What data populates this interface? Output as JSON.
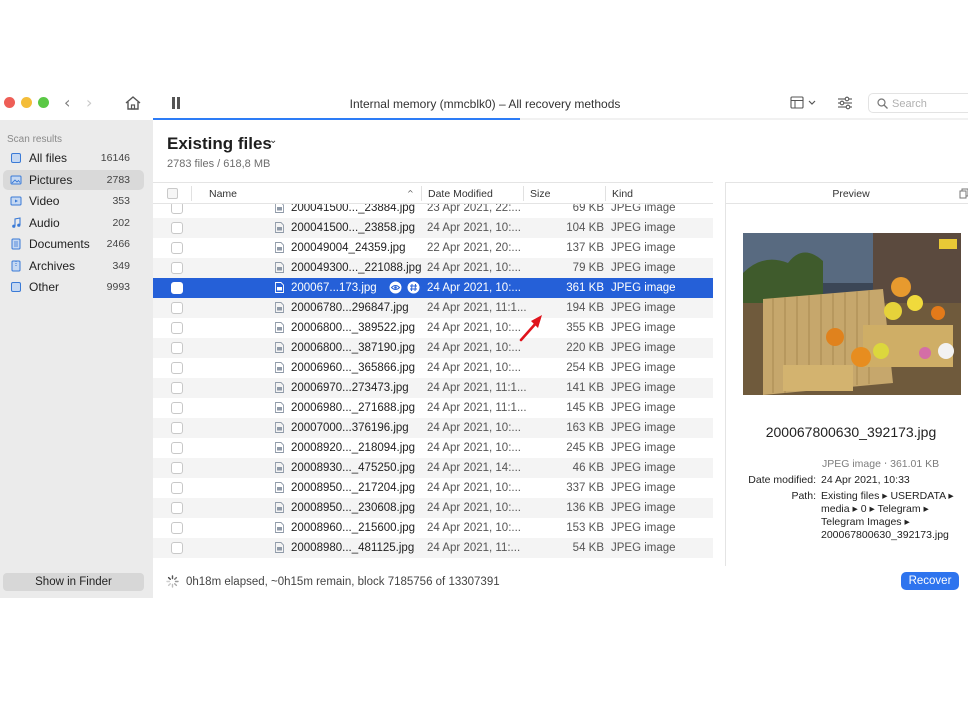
{
  "window": {
    "title": "Internal memory (mmcblk0) – All recovery methods",
    "scan_progress_percent": 45
  },
  "search": {
    "placeholder": "Search"
  },
  "sidebar": {
    "heading": "Scan results",
    "items": [
      {
        "label": "All files",
        "count": "16146",
        "icon": "files-icon"
      },
      {
        "label": "Pictures",
        "count": "2783",
        "icon": "pictures-icon",
        "selected": true
      },
      {
        "label": "Video",
        "count": "353",
        "icon": "video-icon"
      },
      {
        "label": "Audio",
        "count": "202",
        "icon": "audio-icon"
      },
      {
        "label": "Documents",
        "count": "2466",
        "icon": "documents-icon"
      },
      {
        "label": "Archives",
        "count": "349",
        "icon": "archives-icon"
      },
      {
        "label": "Other",
        "count": "9993",
        "icon": "other-icon"
      }
    ],
    "show_in_finder": "Show in Finder"
  },
  "main": {
    "title": "Existing files",
    "subtitle": "2783 files / 618,8 MB",
    "columns": {
      "name": "Name",
      "date": "Date Modified",
      "size": "Size",
      "kind": "Kind"
    },
    "rows": [
      {
        "name": "200041500..._23884.jpg",
        "date": "23 Apr 2021, 22:...",
        "size": "69 KB",
        "kind": "JPEG image"
      },
      {
        "name": "200041500..._23858.jpg",
        "date": "24 Apr 2021, 10:...",
        "size": "104 KB",
        "kind": "JPEG image"
      },
      {
        "name": "200049004_24359.jpg",
        "date": "22 Apr 2021, 20:...",
        "size": "137 KB",
        "kind": "JPEG image"
      },
      {
        "name": "200049300..._221088.jpg",
        "date": "24 Apr 2021, 10:...",
        "size": "79 KB",
        "kind": "JPEG image"
      },
      {
        "name": "200067...173.jpg",
        "date": "24 Apr 2021, 10:...",
        "size": "361 KB",
        "kind": "JPEG image",
        "selected": true
      },
      {
        "name": "20006780...296847.jpg",
        "date": "24 Apr 2021, 11:1...",
        "size": "194 KB",
        "kind": "JPEG image"
      },
      {
        "name": "20006800..._389522.jpg",
        "date": "24 Apr 2021, 10:...",
        "size": "355 KB",
        "kind": "JPEG image"
      },
      {
        "name": "20006800..._387190.jpg",
        "date": "24 Apr 2021, 10:...",
        "size": "220 KB",
        "kind": "JPEG image"
      },
      {
        "name": "20006960..._365866.jpg",
        "date": "24 Apr 2021, 10:...",
        "size": "254 KB",
        "kind": "JPEG image"
      },
      {
        "name": "20006970...273473.jpg",
        "date": "24 Apr 2021, 11:1...",
        "size": "141 KB",
        "kind": "JPEG image"
      },
      {
        "name": "20006980..._271688.jpg",
        "date": "24 Apr 2021, 11:1...",
        "size": "145 KB",
        "kind": "JPEG image"
      },
      {
        "name": "20007000...376196.jpg",
        "date": "24 Apr 2021, 10:...",
        "size": "163 KB",
        "kind": "JPEG image"
      },
      {
        "name": "20008920..._218094.jpg",
        "date": "24 Apr 2021, 10:...",
        "size": "245 KB",
        "kind": "JPEG image"
      },
      {
        "name": "20008930..._475250.jpg",
        "date": "24 Apr 2021, 14:...",
        "size": "46 KB",
        "kind": "JPEG image"
      },
      {
        "name": "20008950..._217204.jpg",
        "date": "24 Apr 2021, 10:...",
        "size": "337 KB",
        "kind": "JPEG image"
      },
      {
        "name": "20008950..._230608.jpg",
        "date": "24 Apr 2021, 10:...",
        "size": "136 KB",
        "kind": "JPEG image"
      },
      {
        "name": "20008960..._215600.jpg",
        "date": "24 Apr 2021, 10:...",
        "size": "153 KB",
        "kind": "JPEG image"
      },
      {
        "name": "20008980..._481125.jpg",
        "date": "24 Apr 2021, 11:...",
        "size": "54 KB",
        "kind": "JPEG image"
      }
    ]
  },
  "preview": {
    "heading": "Preview",
    "filename": "200067800630_392173.jpg",
    "type_size": "JPEG image ‧ 361.01 KB",
    "date_label": "Date modified:",
    "date_value": "24 Apr 2021, 10:33",
    "path_label": "Path:",
    "path_value": "Existing files ▸ USERDATA ▸ media ▸ 0 ▸ Telegram ▸ Telegram Images ▸ 200067800630_392173.jpg"
  },
  "status": {
    "text": "0h18m elapsed, ~0h15m remain, block 7185756 of 13307391",
    "recover_label": "Recover"
  },
  "colors": {
    "accent": "#2560d8",
    "button": "#2e74ee",
    "pointer": "#e0141c"
  }
}
